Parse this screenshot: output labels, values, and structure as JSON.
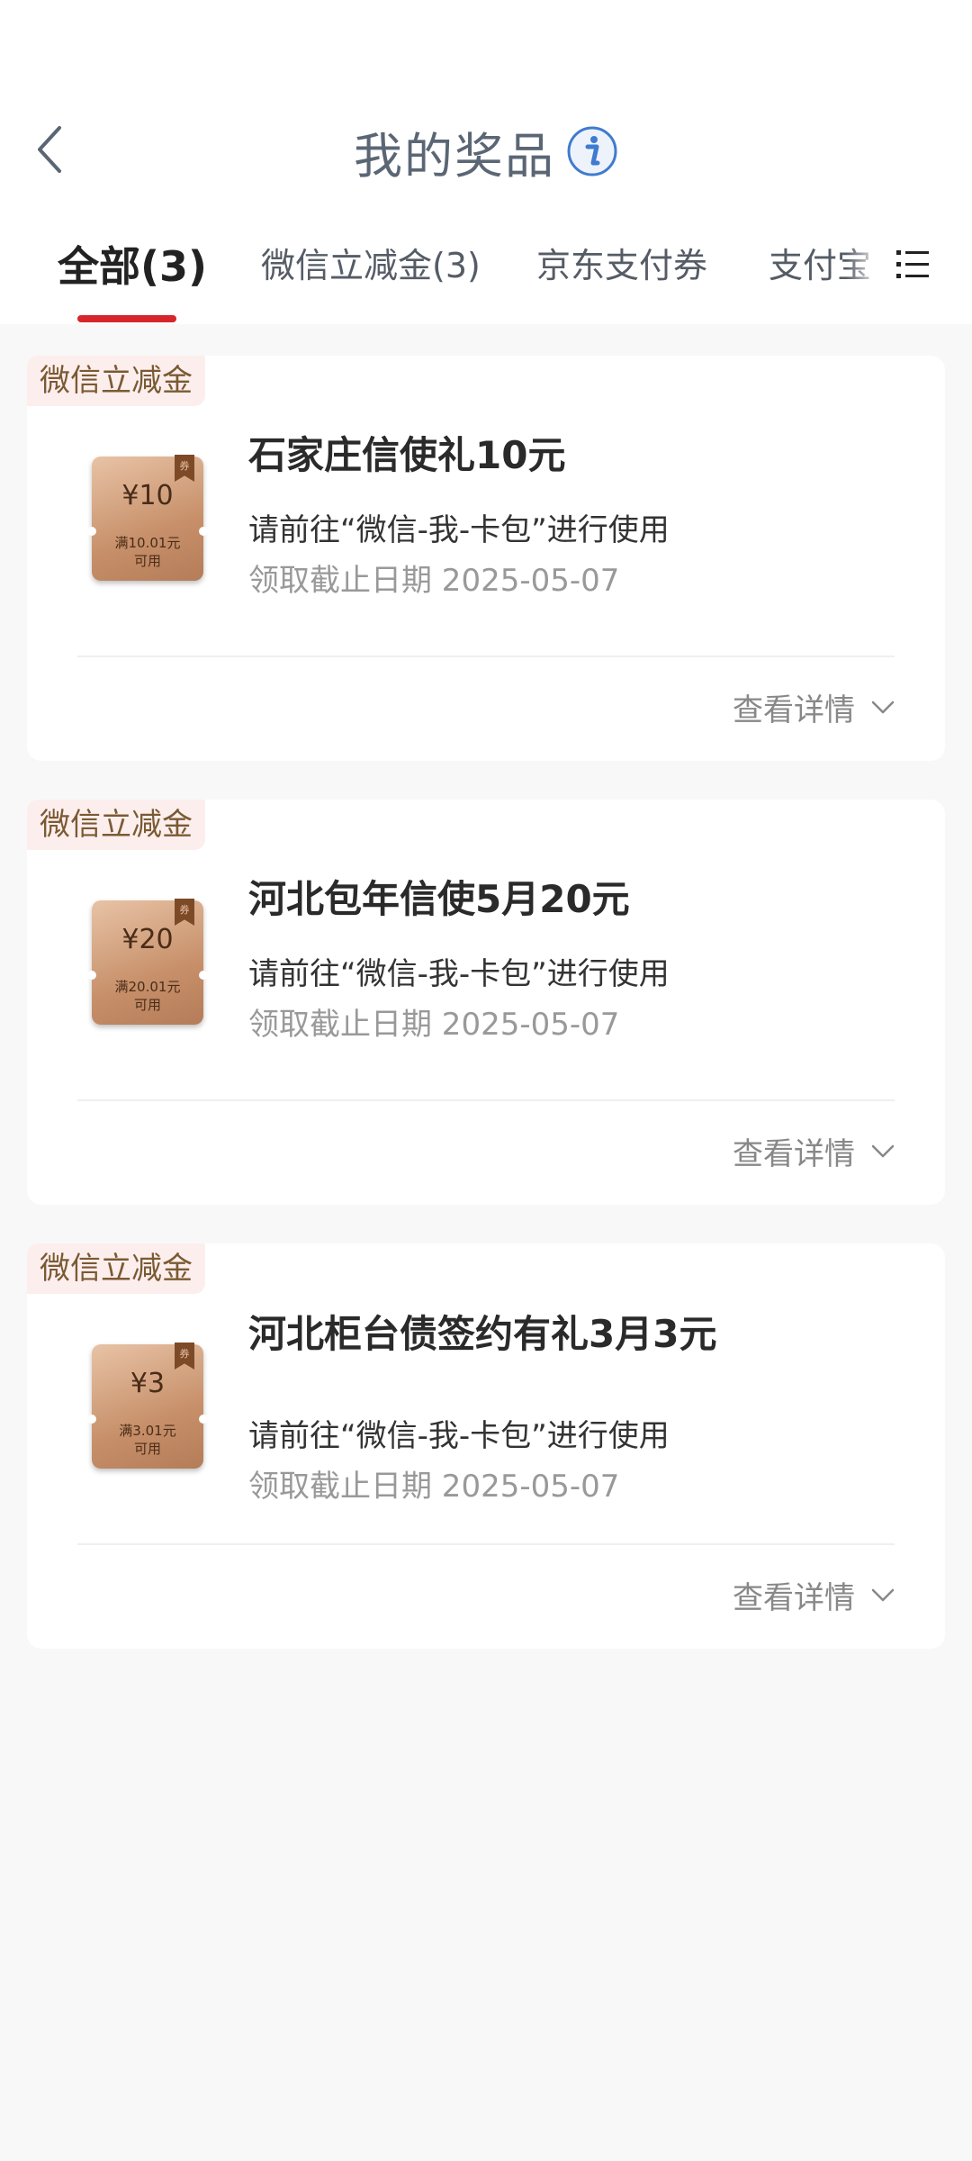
{
  "header": {
    "title": "我的奖品",
    "back_icon": "chevron-left-icon",
    "info_icon": "info-icon"
  },
  "tabs": [
    {
      "label": "全部(3)",
      "active": true
    },
    {
      "label": "微信立减金(3)",
      "active": false
    },
    {
      "label": "京东支付券",
      "active": false
    },
    {
      "label": "支付宝",
      "active": false
    }
  ],
  "tabs_menu_icon": "list-menu-icon",
  "colors": {
    "accent": "#d6252b",
    "tag_bg": "#fdeeee",
    "tag_text": "#7a5a32",
    "coupon": "#c7906a"
  },
  "prizes": [
    {
      "tag": "微信立减金",
      "coupon_amount": "¥10",
      "coupon_condition_line1": "满10.01元",
      "coupon_condition_line2": "可用",
      "coupon_badge": "券",
      "name": "石家庄信使礼10元",
      "hint": "请前往“微信-我-卡包”进行使用",
      "deadline": "领取截止日期 2025-05-07",
      "detail_label": "查看详情"
    },
    {
      "tag": "微信立减金",
      "coupon_amount": "¥20",
      "coupon_condition_line1": "满20.01元",
      "coupon_condition_line2": "可用",
      "coupon_badge": "券",
      "name": "河北包年信使5月20元",
      "hint": "请前往“微信-我-卡包”进行使用",
      "deadline": "领取截止日期 2025-05-07",
      "detail_label": "查看详情"
    },
    {
      "tag": "微信立减金",
      "coupon_amount": "¥3",
      "coupon_condition_line1": "满3.01元",
      "coupon_condition_line2": "可用",
      "coupon_badge": "券",
      "name": "河北柜台债签约有礼3月3元",
      "hint": "请前往“微信-我-卡包”进行使用",
      "deadline": "领取截止日期 2025-05-07",
      "detail_label": "查看详情"
    }
  ]
}
